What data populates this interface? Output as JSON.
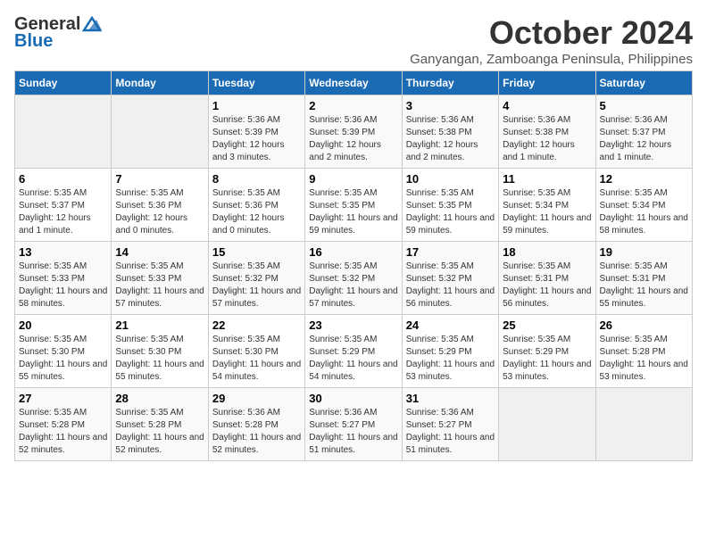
{
  "logo": {
    "general": "General",
    "blue": "Blue"
  },
  "title": {
    "month": "October 2024",
    "location": "Ganyangan, Zamboanga Peninsula, Philippines"
  },
  "headers": [
    "Sunday",
    "Monday",
    "Tuesday",
    "Wednesday",
    "Thursday",
    "Friday",
    "Saturday"
  ],
  "weeks": [
    [
      {
        "day": "",
        "detail": ""
      },
      {
        "day": "",
        "detail": ""
      },
      {
        "day": "1",
        "detail": "Sunrise: 5:36 AM\nSunset: 5:39 PM\nDaylight: 12 hours and 3 minutes."
      },
      {
        "day": "2",
        "detail": "Sunrise: 5:36 AM\nSunset: 5:39 PM\nDaylight: 12 hours and 2 minutes."
      },
      {
        "day": "3",
        "detail": "Sunrise: 5:36 AM\nSunset: 5:38 PM\nDaylight: 12 hours and 2 minutes."
      },
      {
        "day": "4",
        "detail": "Sunrise: 5:36 AM\nSunset: 5:38 PM\nDaylight: 12 hours and 1 minute."
      },
      {
        "day": "5",
        "detail": "Sunrise: 5:36 AM\nSunset: 5:37 PM\nDaylight: 12 hours and 1 minute."
      }
    ],
    [
      {
        "day": "6",
        "detail": "Sunrise: 5:35 AM\nSunset: 5:37 PM\nDaylight: 12 hours and 1 minute."
      },
      {
        "day": "7",
        "detail": "Sunrise: 5:35 AM\nSunset: 5:36 PM\nDaylight: 12 hours and 0 minutes."
      },
      {
        "day": "8",
        "detail": "Sunrise: 5:35 AM\nSunset: 5:36 PM\nDaylight: 12 hours and 0 minutes."
      },
      {
        "day": "9",
        "detail": "Sunrise: 5:35 AM\nSunset: 5:35 PM\nDaylight: 11 hours and 59 minutes."
      },
      {
        "day": "10",
        "detail": "Sunrise: 5:35 AM\nSunset: 5:35 PM\nDaylight: 11 hours and 59 minutes."
      },
      {
        "day": "11",
        "detail": "Sunrise: 5:35 AM\nSunset: 5:34 PM\nDaylight: 11 hours and 59 minutes."
      },
      {
        "day": "12",
        "detail": "Sunrise: 5:35 AM\nSunset: 5:34 PM\nDaylight: 11 hours and 58 minutes."
      }
    ],
    [
      {
        "day": "13",
        "detail": "Sunrise: 5:35 AM\nSunset: 5:33 PM\nDaylight: 11 hours and 58 minutes."
      },
      {
        "day": "14",
        "detail": "Sunrise: 5:35 AM\nSunset: 5:33 PM\nDaylight: 11 hours and 57 minutes."
      },
      {
        "day": "15",
        "detail": "Sunrise: 5:35 AM\nSunset: 5:32 PM\nDaylight: 11 hours and 57 minutes."
      },
      {
        "day": "16",
        "detail": "Sunrise: 5:35 AM\nSunset: 5:32 PM\nDaylight: 11 hours and 57 minutes."
      },
      {
        "day": "17",
        "detail": "Sunrise: 5:35 AM\nSunset: 5:32 PM\nDaylight: 11 hours and 56 minutes."
      },
      {
        "day": "18",
        "detail": "Sunrise: 5:35 AM\nSunset: 5:31 PM\nDaylight: 11 hours and 56 minutes."
      },
      {
        "day": "19",
        "detail": "Sunrise: 5:35 AM\nSunset: 5:31 PM\nDaylight: 11 hours and 55 minutes."
      }
    ],
    [
      {
        "day": "20",
        "detail": "Sunrise: 5:35 AM\nSunset: 5:30 PM\nDaylight: 11 hours and 55 minutes."
      },
      {
        "day": "21",
        "detail": "Sunrise: 5:35 AM\nSunset: 5:30 PM\nDaylight: 11 hours and 55 minutes."
      },
      {
        "day": "22",
        "detail": "Sunrise: 5:35 AM\nSunset: 5:30 PM\nDaylight: 11 hours and 54 minutes."
      },
      {
        "day": "23",
        "detail": "Sunrise: 5:35 AM\nSunset: 5:29 PM\nDaylight: 11 hours and 54 minutes."
      },
      {
        "day": "24",
        "detail": "Sunrise: 5:35 AM\nSunset: 5:29 PM\nDaylight: 11 hours and 53 minutes."
      },
      {
        "day": "25",
        "detail": "Sunrise: 5:35 AM\nSunset: 5:29 PM\nDaylight: 11 hours and 53 minutes."
      },
      {
        "day": "26",
        "detail": "Sunrise: 5:35 AM\nSunset: 5:28 PM\nDaylight: 11 hours and 53 minutes."
      }
    ],
    [
      {
        "day": "27",
        "detail": "Sunrise: 5:35 AM\nSunset: 5:28 PM\nDaylight: 11 hours and 52 minutes."
      },
      {
        "day": "28",
        "detail": "Sunrise: 5:35 AM\nSunset: 5:28 PM\nDaylight: 11 hours and 52 minutes."
      },
      {
        "day": "29",
        "detail": "Sunrise: 5:36 AM\nSunset: 5:28 PM\nDaylight: 11 hours and 52 minutes."
      },
      {
        "day": "30",
        "detail": "Sunrise: 5:36 AM\nSunset: 5:27 PM\nDaylight: 11 hours and 51 minutes."
      },
      {
        "day": "31",
        "detail": "Sunrise: 5:36 AM\nSunset: 5:27 PM\nDaylight: 11 hours and 51 minutes."
      },
      {
        "day": "",
        "detail": ""
      },
      {
        "day": "",
        "detail": ""
      }
    ]
  ]
}
